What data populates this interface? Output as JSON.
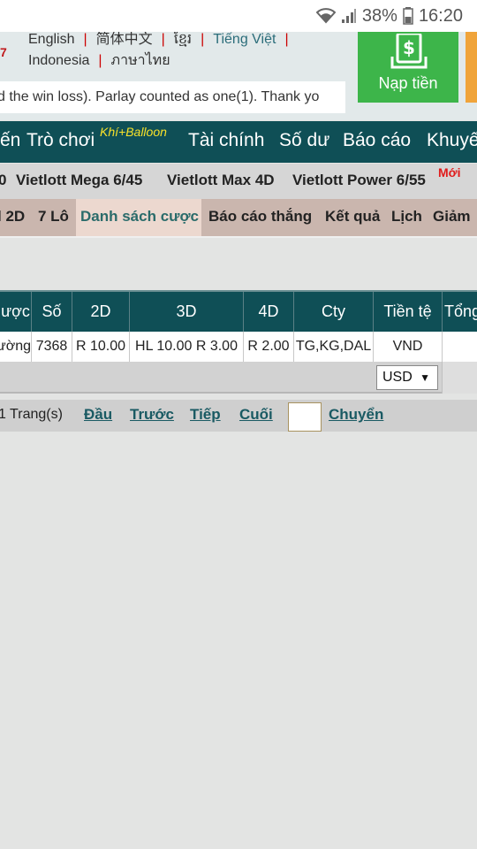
{
  "status_bar": {
    "battery": "38%",
    "time": "16:20"
  },
  "header": {
    "lang_row1": [
      "English",
      "简体中文",
      "ខ្មែរ",
      "Tiếng Việt"
    ],
    "lang_row2": [
      "Indonesia",
      "ภาษาไทย"
    ],
    "side_number": "7",
    "notice": "d the win loss). Parlay counted as one(1). Thank yo",
    "deposit_label": "Nạp tiền"
  },
  "main_nav": {
    "items": [
      "ến",
      "Trò chơi",
      "Tài chính",
      "Số dư",
      "Báo cáo",
      "Khuyế"
    ],
    "balloon": "Khí+Balloon"
  },
  "vietlott_nav": {
    "items": [
      "0",
      "Vietlott Mega 6/45",
      "Vietlott Max 4D",
      "Vietlott Power 6/55"
    ],
    "new_badge": "Mới"
  },
  "bet_nav": {
    "items": [
      "l 2D",
      "7 Lô",
      "Danh sách cược",
      "Báo cáo thắng",
      "Kết quả",
      "Lịch",
      "Giảm"
    ],
    "active_index": 2
  },
  "table": {
    "headers": [
      "ược",
      "Số",
      "2D",
      "3D",
      "4D",
      "Cty",
      "Tiền tệ",
      "Tổng"
    ],
    "row": [
      "ường",
      "7368",
      "R 10.00",
      "HL 10.00 R 3.00",
      "R 2.00",
      "TG,KG,DAL",
      "VND",
      ""
    ],
    "currency_select": "USD"
  },
  "pager": {
    "pages_text": "1 Trang(s)",
    "first": "Đầu",
    "prev": "Trước",
    "next": "Tiếp",
    "last": "Cuối",
    "page_input": "",
    "go": "Chuyển"
  },
  "colors": {
    "nav_teal": "#0f4f56",
    "deposit_green": "#3db54a",
    "balloon_yellow": "#f7e12a",
    "new_red": "#e01b1b",
    "active_tab_bg": "#ecd8cf"
  }
}
